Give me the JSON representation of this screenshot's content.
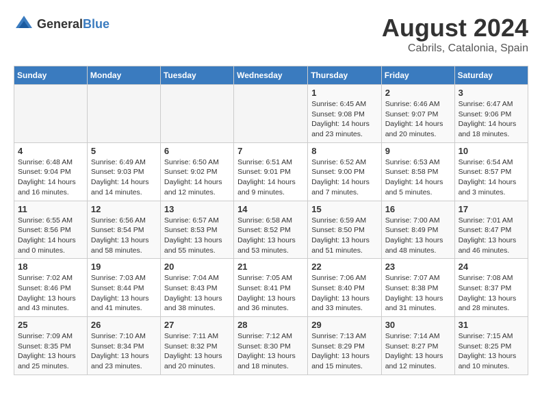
{
  "header": {
    "logo_general": "General",
    "logo_blue": "Blue",
    "month_title": "August 2024",
    "location": "Cabrils, Catalonia, Spain"
  },
  "days_of_week": [
    "Sunday",
    "Monday",
    "Tuesday",
    "Wednesday",
    "Thursday",
    "Friday",
    "Saturday"
  ],
  "weeks": [
    [
      {
        "day": "",
        "info": ""
      },
      {
        "day": "",
        "info": ""
      },
      {
        "day": "",
        "info": ""
      },
      {
        "day": "",
        "info": ""
      },
      {
        "day": "1",
        "info": "Sunrise: 6:45 AM\nSunset: 9:08 PM\nDaylight: 14 hours\nand 23 minutes."
      },
      {
        "day": "2",
        "info": "Sunrise: 6:46 AM\nSunset: 9:07 PM\nDaylight: 14 hours\nand 20 minutes."
      },
      {
        "day": "3",
        "info": "Sunrise: 6:47 AM\nSunset: 9:06 PM\nDaylight: 14 hours\nand 18 minutes."
      }
    ],
    [
      {
        "day": "4",
        "info": "Sunrise: 6:48 AM\nSunset: 9:04 PM\nDaylight: 14 hours\nand 16 minutes."
      },
      {
        "day": "5",
        "info": "Sunrise: 6:49 AM\nSunset: 9:03 PM\nDaylight: 14 hours\nand 14 minutes."
      },
      {
        "day": "6",
        "info": "Sunrise: 6:50 AM\nSunset: 9:02 PM\nDaylight: 14 hours\nand 12 minutes."
      },
      {
        "day": "7",
        "info": "Sunrise: 6:51 AM\nSunset: 9:01 PM\nDaylight: 14 hours\nand 9 minutes."
      },
      {
        "day": "8",
        "info": "Sunrise: 6:52 AM\nSunset: 9:00 PM\nDaylight: 14 hours\nand 7 minutes."
      },
      {
        "day": "9",
        "info": "Sunrise: 6:53 AM\nSunset: 8:58 PM\nDaylight: 14 hours\nand 5 minutes."
      },
      {
        "day": "10",
        "info": "Sunrise: 6:54 AM\nSunset: 8:57 PM\nDaylight: 14 hours\nand 3 minutes."
      }
    ],
    [
      {
        "day": "11",
        "info": "Sunrise: 6:55 AM\nSunset: 8:56 PM\nDaylight: 14 hours\nand 0 minutes."
      },
      {
        "day": "12",
        "info": "Sunrise: 6:56 AM\nSunset: 8:54 PM\nDaylight: 13 hours\nand 58 minutes."
      },
      {
        "day": "13",
        "info": "Sunrise: 6:57 AM\nSunset: 8:53 PM\nDaylight: 13 hours\nand 55 minutes."
      },
      {
        "day": "14",
        "info": "Sunrise: 6:58 AM\nSunset: 8:52 PM\nDaylight: 13 hours\nand 53 minutes."
      },
      {
        "day": "15",
        "info": "Sunrise: 6:59 AM\nSunset: 8:50 PM\nDaylight: 13 hours\nand 51 minutes."
      },
      {
        "day": "16",
        "info": "Sunrise: 7:00 AM\nSunset: 8:49 PM\nDaylight: 13 hours\nand 48 minutes."
      },
      {
        "day": "17",
        "info": "Sunrise: 7:01 AM\nSunset: 8:47 PM\nDaylight: 13 hours\nand 46 minutes."
      }
    ],
    [
      {
        "day": "18",
        "info": "Sunrise: 7:02 AM\nSunset: 8:46 PM\nDaylight: 13 hours\nand 43 minutes."
      },
      {
        "day": "19",
        "info": "Sunrise: 7:03 AM\nSunset: 8:44 PM\nDaylight: 13 hours\nand 41 minutes."
      },
      {
        "day": "20",
        "info": "Sunrise: 7:04 AM\nSunset: 8:43 PM\nDaylight: 13 hours\nand 38 minutes."
      },
      {
        "day": "21",
        "info": "Sunrise: 7:05 AM\nSunset: 8:41 PM\nDaylight: 13 hours\nand 36 minutes."
      },
      {
        "day": "22",
        "info": "Sunrise: 7:06 AM\nSunset: 8:40 PM\nDaylight: 13 hours\nand 33 minutes."
      },
      {
        "day": "23",
        "info": "Sunrise: 7:07 AM\nSunset: 8:38 PM\nDaylight: 13 hours\nand 31 minutes."
      },
      {
        "day": "24",
        "info": "Sunrise: 7:08 AM\nSunset: 8:37 PM\nDaylight: 13 hours\nand 28 minutes."
      }
    ],
    [
      {
        "day": "25",
        "info": "Sunrise: 7:09 AM\nSunset: 8:35 PM\nDaylight: 13 hours\nand 25 minutes."
      },
      {
        "day": "26",
        "info": "Sunrise: 7:10 AM\nSunset: 8:34 PM\nDaylight: 13 hours\nand 23 minutes."
      },
      {
        "day": "27",
        "info": "Sunrise: 7:11 AM\nSunset: 8:32 PM\nDaylight: 13 hours\nand 20 minutes."
      },
      {
        "day": "28",
        "info": "Sunrise: 7:12 AM\nSunset: 8:30 PM\nDaylight: 13 hours\nand 18 minutes."
      },
      {
        "day": "29",
        "info": "Sunrise: 7:13 AM\nSunset: 8:29 PM\nDaylight: 13 hours\nand 15 minutes."
      },
      {
        "day": "30",
        "info": "Sunrise: 7:14 AM\nSunset: 8:27 PM\nDaylight: 13 hours\nand 12 minutes."
      },
      {
        "day": "31",
        "info": "Sunrise: 7:15 AM\nSunset: 8:25 PM\nDaylight: 13 hours\nand 10 minutes."
      }
    ]
  ]
}
